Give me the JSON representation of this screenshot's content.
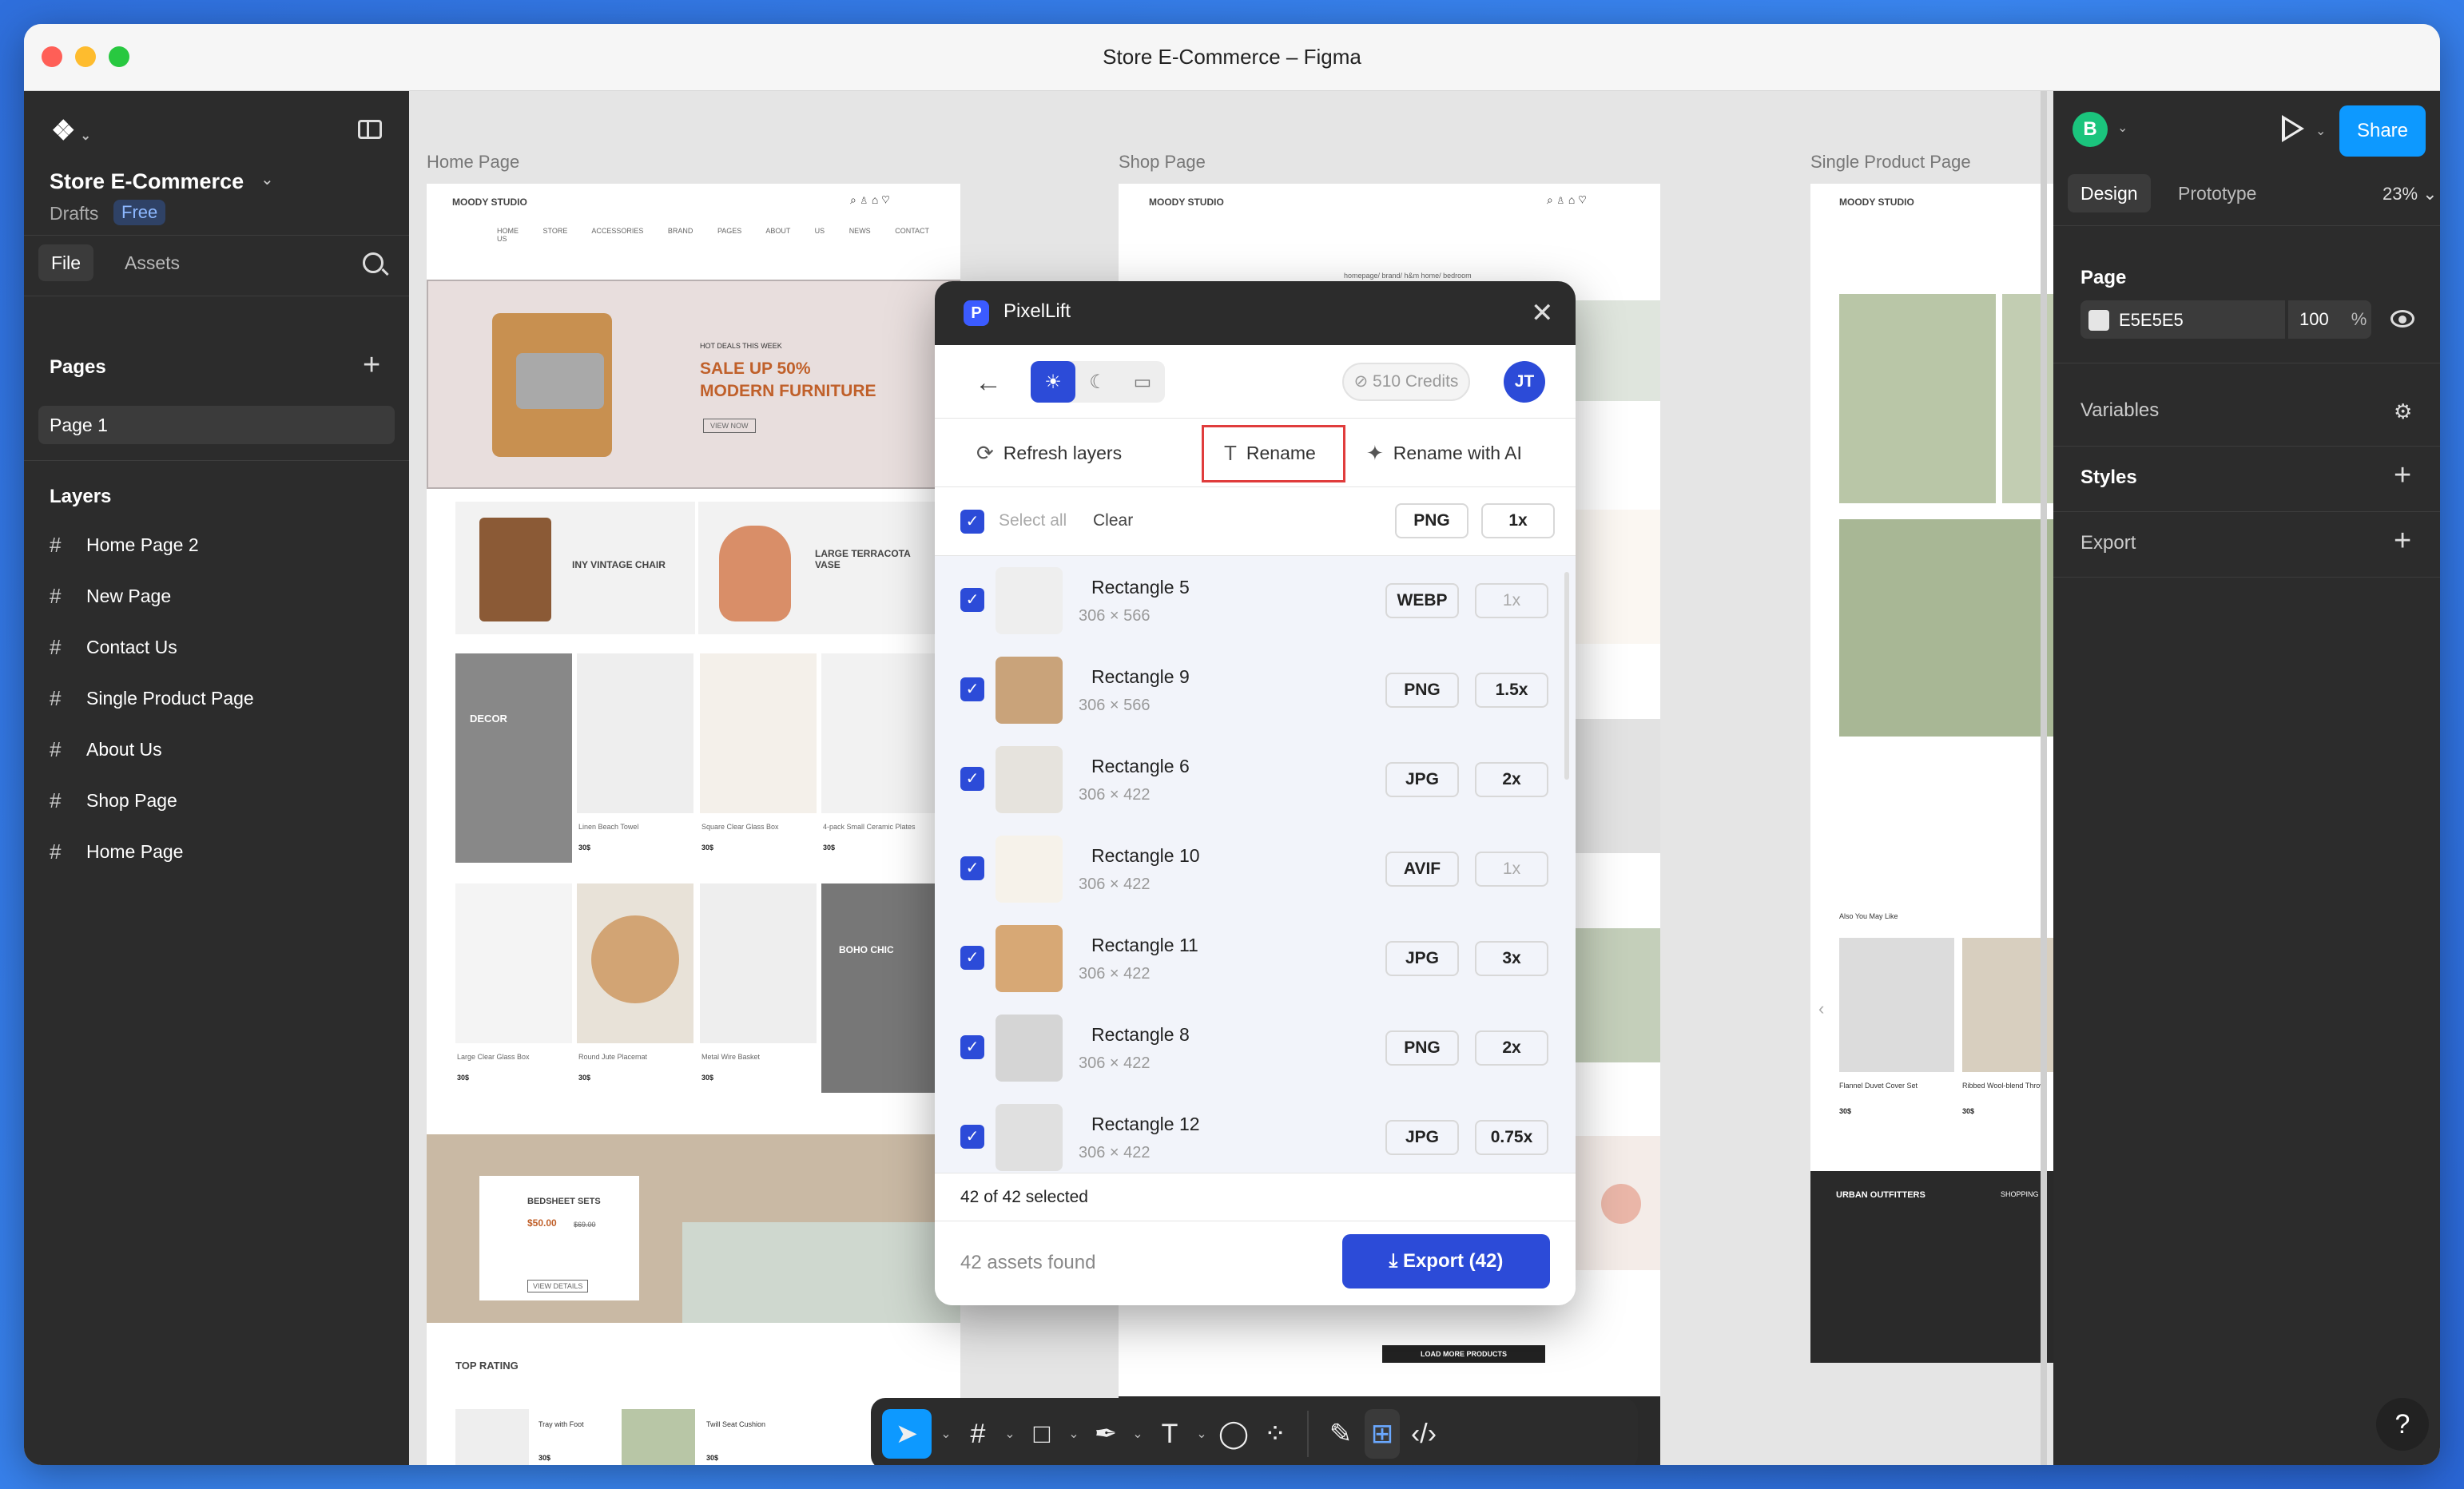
{
  "window": {
    "title": "Store E-Commerce – Figma"
  },
  "left": {
    "project_name": "Store E-Commerce",
    "drafts": "Drafts",
    "plan": "Free",
    "tabs": [
      "File",
      "Assets"
    ],
    "pages_title": "Pages",
    "pages": [
      "Page 1"
    ],
    "layers_title": "Layers",
    "layers": [
      "Home Page 2",
      "New Page",
      "Contact Us",
      "Single Product Page",
      "About Us",
      "Shop Page",
      "Home Page"
    ]
  },
  "canvas": {
    "frames": [
      "Home Page",
      "Shop Page",
      "Single Product Page"
    ],
    "home": {
      "brand": "MOODY STUDIO",
      "nav": [
        "HOME",
        "STORE",
        "ACCESSORIES",
        "BRAND",
        "PAGES",
        "ABOUT US",
        "NEWS",
        "CONTACT US"
      ],
      "hero_kicker": "HOT DEALS THIS WEEK",
      "hero_title1": "SALE UP 50%",
      "hero_title2": "MODERN FURNITURE",
      "hero_btn": "VIEW NOW",
      "promo1": "INY VINTAGE CHAIR",
      "promo2": "LARGE TERRACOTA VASE",
      "decor": "DECOR",
      "products1": [
        {
          "name": "Linen Beach Towel",
          "price": "30$"
        },
        {
          "name": "Square Clear Glass Box",
          "price": "30$"
        },
        {
          "name": "4-pack Small Ceramic Plates",
          "price": "30$"
        }
      ],
      "products2": [
        {
          "name": "Large Clear Glass Box",
          "price": "30$"
        },
        {
          "name": "Round Jute Placemat",
          "price": "30$"
        },
        {
          "name": "Metal Wire Basket",
          "price": "30$"
        }
      ],
      "boho": "BOHO CHIC",
      "bedsheet_title": "BEDSHEET SETS",
      "bedsheet_price": "$50.00",
      "bedsheet_old": "$69.00",
      "bedsheet_btn": "VIEW DETAILS",
      "top_rating": "TOP RATING",
      "tr1": "Tray with Foot",
      "tr2": "Twill Seat Cushion",
      "tr_price": "30$"
    },
    "shop": {
      "brand": "MOODY STUDIO",
      "breadcrumb": "homepage/ brand/ h&m home/ bedroom",
      "load_more": "LOAD MORE PRODUCTS"
    },
    "single": {
      "brand": "MOODY STUDIO",
      "also": "Also You May Like",
      "p1": "Flannel Duvet Cover Set",
      "p2": "Ribbed Wool-blend Throw",
      "price": "30$",
      "footer_brand": "URBAN OUTFITTERS",
      "footer_shopping": "SHOPPING"
    }
  },
  "toolbar": {
    "tools": [
      "move",
      "frame",
      "rectangle",
      "pen",
      "text",
      "comment",
      "actions"
    ]
  },
  "right": {
    "avatar": "B",
    "share": "Share",
    "tabs": [
      "Design",
      "Prototype"
    ],
    "zoom": "23%",
    "page_title": "Page",
    "bg_color": "E5E5E5",
    "opacity": "100",
    "opacity_unit": "%",
    "variables": "Variables",
    "styles": "Styles",
    "export": "Export",
    "help": "?"
  },
  "plugin": {
    "title": "PixelLift",
    "credits": "510 Credits",
    "user": "JT",
    "actions": [
      "Refresh layers",
      "Rename",
      "Rename with AI"
    ],
    "select_all": "Select all",
    "clear": "Clear",
    "default_format": "PNG",
    "default_scale": "1x",
    "assets": [
      {
        "name": "Rectangle 5",
        "dims": "306 × 566",
        "format": "WEBP",
        "scale": "1x"
      },
      {
        "name": "Rectangle 9",
        "dims": "306 × 566",
        "format": "PNG",
        "scale": "1.5x"
      },
      {
        "name": "Rectangle 6",
        "dims": "306 × 422",
        "format": "JPG",
        "scale": "2x"
      },
      {
        "name": "Rectangle 10",
        "dims": "306 × 422",
        "format": "AVIF",
        "scale": "1x"
      },
      {
        "name": "Rectangle 11",
        "dims": "306 × 422",
        "format": "JPG",
        "scale": "3x"
      },
      {
        "name": "Rectangle 8",
        "dims": "306 × 422",
        "format": "PNG",
        "scale": "2x"
      },
      {
        "name": "Rectangle 12",
        "dims": "306 × 422",
        "format": "JPG",
        "scale": "0.75x"
      }
    ],
    "selected_count": "42 of 42 selected",
    "found": "42 assets found",
    "export_btn": "Export (42)"
  }
}
